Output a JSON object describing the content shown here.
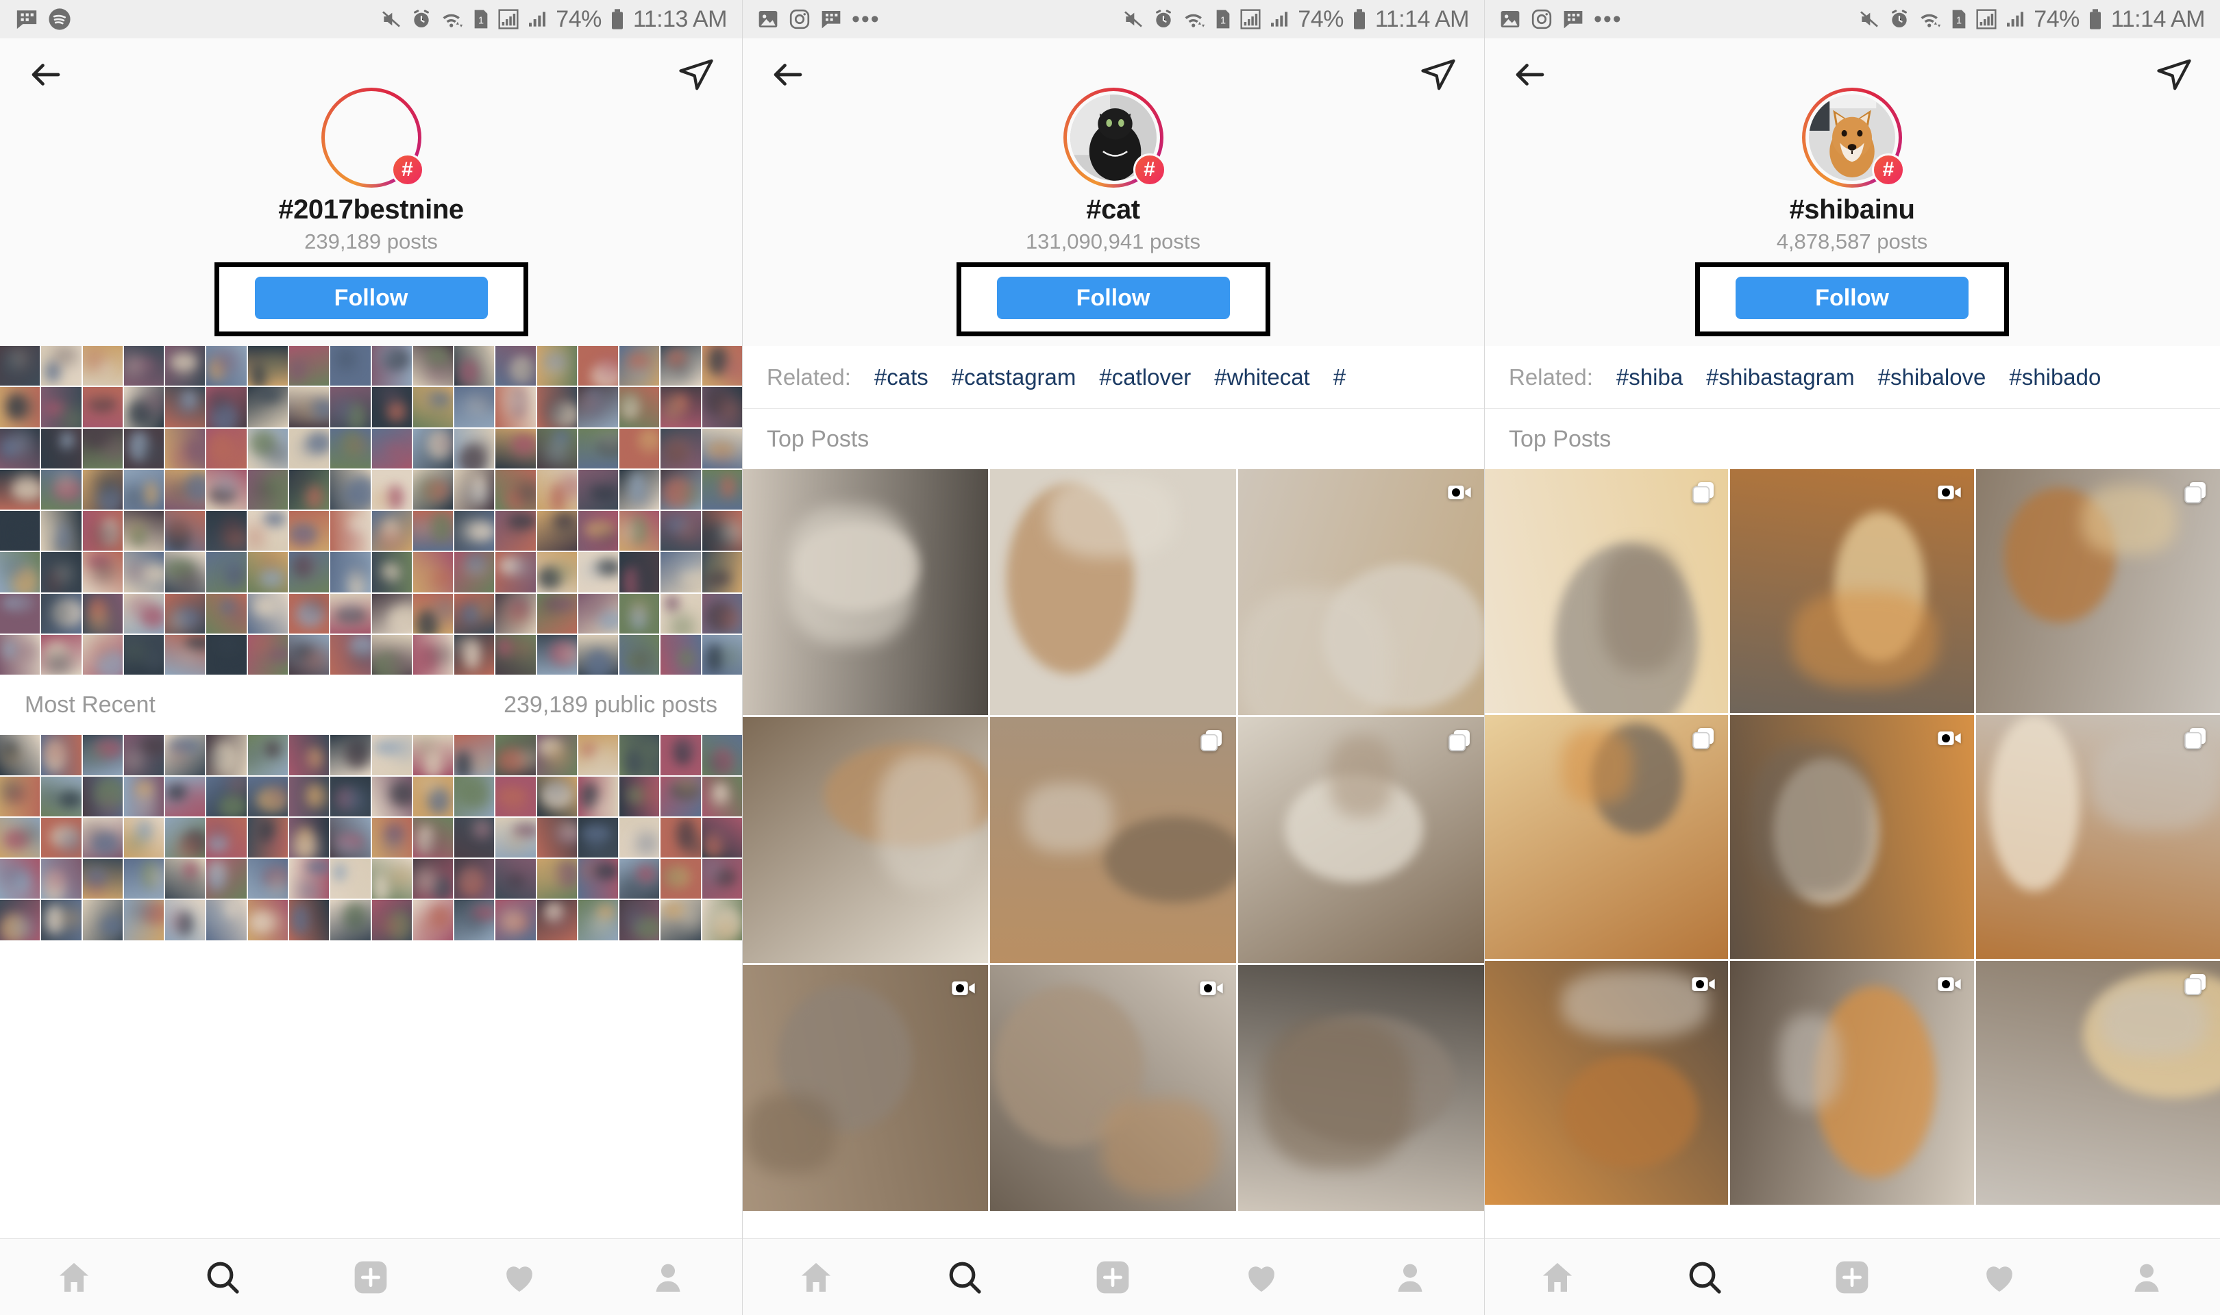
{
  "theme": {
    "accent_blue": "#3897f0",
    "link_navy": "#1b3a63",
    "muted_gray": "#999999",
    "status_gray": "#6e6e6e",
    "bg": "#fafafa",
    "annotation_outline": "#000000"
  },
  "panels": [
    {
      "id": "panel-2017bestnine",
      "statusbar": {
        "left_icons": [
          "message-icon",
          "spotify-icon"
        ],
        "right_icons": [
          "mute-icon",
          "alarm-icon",
          "wifi-icon",
          "sim1-icon",
          "signal-boxed-icon",
          "signal-icon"
        ],
        "battery": "74%",
        "battery_icon": "battery-icon",
        "time": "11:13 AM"
      },
      "topnav": {
        "back_icon": "back-arrow-icon",
        "direct_icon": "direct-message-icon"
      },
      "header": {
        "avatar_icon": "hashtag-avatar-empty",
        "badge": "#",
        "hashtag": "#2017bestnine",
        "posts": "239,189 posts",
        "follow_label": "Follow",
        "annotated": true
      },
      "related": null,
      "sections": [
        {
          "title": "Most Recent",
          "right": "239,189 public posts"
        }
      ],
      "grid_kind": "collage"
    },
    {
      "id": "panel-cat",
      "statusbar": {
        "left_icons": [
          "photo-icon",
          "instagram-icon",
          "message-icon",
          "overflow-dots-icon"
        ],
        "right_icons": [
          "mute-icon",
          "alarm-icon",
          "wifi-icon",
          "sim1-icon",
          "signal-boxed-icon",
          "signal-icon"
        ],
        "battery": "74%",
        "battery_icon": "battery-icon",
        "time": "11:14 AM"
      },
      "topnav": {
        "back_icon": "back-arrow-icon",
        "direct_icon": "direct-message-icon"
      },
      "header": {
        "avatar_icon": "black-cat-photo",
        "badge": "#",
        "hashtag": "#cat",
        "posts": "131,090,941 posts",
        "follow_label": "Follow",
        "annotated": true
      },
      "related": {
        "label": "Related:",
        "tags": [
          "#cats",
          "#catstagram",
          "#catlover",
          "#whitecat",
          "#"
        ]
      },
      "sections": [
        {
          "title": "Top Posts",
          "right": ""
        }
      ],
      "grid_kind": "photos",
      "posts": [
        {
          "alt": "two cats sleeping",
          "media": "none"
        },
        {
          "alt": "gray tabby kitten held in hand",
          "media": "none"
        },
        {
          "alt": "orange cat in purple blanket",
          "media": "video"
        },
        {
          "alt": "calico cat lying on rug",
          "media": "none"
        },
        {
          "alt": "white cat on patterned blanket",
          "media": "carousel"
        },
        {
          "alt": "white cat curled on box",
          "media": "carousel"
        },
        {
          "alt": "white cat yawning on couch",
          "media": "video"
        },
        {
          "alt": "cat beside wooden cabinet",
          "media": "video"
        },
        {
          "alt": "cats on forest floor leaves",
          "media": "none"
        }
      ]
    },
    {
      "id": "panel-shibainu",
      "statusbar": {
        "left_icons": [
          "photo-icon",
          "instagram-icon",
          "message-icon",
          "overflow-dots-icon"
        ],
        "right_icons": [
          "mute-icon",
          "alarm-icon",
          "wifi-icon",
          "sim1-icon",
          "signal-boxed-icon",
          "signal-icon"
        ],
        "battery": "74%",
        "battery_icon": "battery-icon",
        "time": "11:14 AM"
      },
      "topnav": {
        "back_icon": "back-arrow-icon",
        "direct_icon": "direct-message-icon"
      },
      "header": {
        "avatar_icon": "shiba-inu-photo",
        "badge": "#",
        "hashtag": "#shibainu",
        "posts": "4,878,587 posts",
        "follow_label": "Follow",
        "annotated": true
      },
      "related": {
        "label": "Related:",
        "tags": [
          "#shiba",
          "#shibastagram",
          "#shibalove",
          "#shibado"
        ]
      },
      "sections": [
        {
          "title": "Top Posts",
          "right": ""
        }
      ],
      "grid_kind": "photos",
      "posts": [
        {
          "alt": "shiba under yellow towel",
          "media": "carousel"
        },
        {
          "alt": "shiba behind guitar strings",
          "media": "video"
        },
        {
          "alt": "shiba on rug in living room",
          "media": "carousel"
        },
        {
          "alt": "shiba on pink dotted blanket",
          "media": "carousel"
        },
        {
          "alt": "shiba stretching on pavement",
          "media": "video"
        },
        {
          "alt": "shiba held up in doorway",
          "media": "carousel"
        },
        {
          "alt": "shiba portrait on gray carpet",
          "media": "video"
        },
        {
          "alt": "shiba on gray stairs",
          "media": "video"
        },
        {
          "alt": "shiba on star patterned rug",
          "media": "carousel"
        }
      ]
    }
  ],
  "tabbar": {
    "items": [
      {
        "name": "home-icon",
        "label": "Home",
        "active": false
      },
      {
        "name": "search-icon",
        "label": "Search",
        "active": true
      },
      {
        "name": "add-post-icon",
        "label": "New Post",
        "active": false
      },
      {
        "name": "activity-heart-icon",
        "label": "Activity",
        "active": false
      },
      {
        "name": "profile-icon",
        "label": "Profile",
        "active": false
      }
    ]
  }
}
